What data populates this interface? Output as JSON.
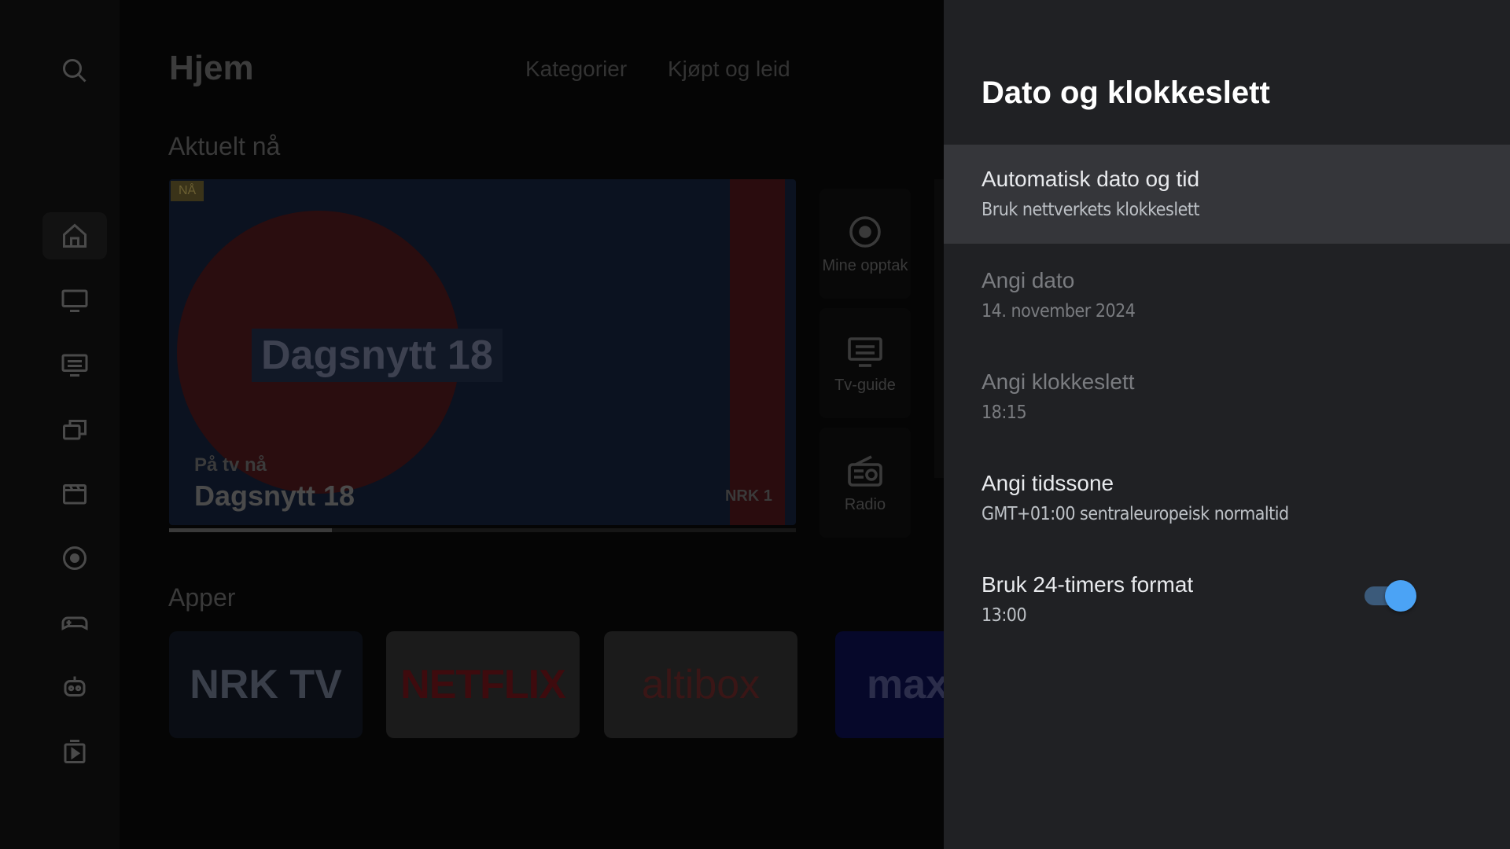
{
  "home": {
    "title": "Hjem",
    "tabs": [
      "Kategorier",
      "Kjøpt og leid"
    ],
    "now_section": "Aktuelt nå",
    "hero": {
      "badge": "NÅ",
      "overlay_title": "Dagsnytt 18",
      "kicker": "På tv nå",
      "title": "Dagsnytt 18",
      "channel": "NRK 1",
      "progress": 0.26
    },
    "shortcuts": [
      "Mine opptak",
      "Tv-guide",
      "Radio"
    ],
    "apps_section": "Apper",
    "apps": [
      "NRK TV",
      "NETFLIX",
      "altibox",
      "max"
    ]
  },
  "settings": {
    "title": "Dato og klokkeslett",
    "options": [
      {
        "title": "Automatisk dato og tid",
        "subtitle": "Bruk nettverkets klokkeslett"
      },
      {
        "title": "Angi dato",
        "subtitle": "14. november 2024"
      },
      {
        "title": "Angi klokkeslett",
        "subtitle": "18:15"
      },
      {
        "title": "Angi tidssone",
        "subtitle": "GMT+01:00 sentraleuropeisk normaltid"
      },
      {
        "title": "Bruk 24-timers format",
        "subtitle": "13:00"
      }
    ],
    "toggle_24h_on": true
  },
  "colors": {
    "panel_bg": "#202124",
    "focused_row": "#35363a",
    "toggle_accent": "#4ba3f5"
  }
}
